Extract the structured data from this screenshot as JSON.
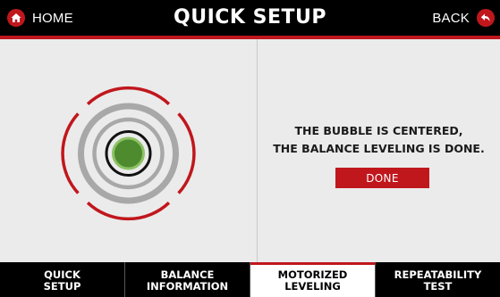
{
  "header": {
    "home_label": "HOME",
    "title": "QUICK SETUP",
    "back_label": "BACK"
  },
  "icons": {
    "home": "home-icon",
    "back": "back-arrow-icon"
  },
  "status": {
    "line1": "THE BUBBLE IS CENTERED,",
    "line2": "THE BALANCE LEVELING IS DONE."
  },
  "actions": {
    "done_label": "DONE"
  },
  "tabs": [
    {
      "line1": "QUICK",
      "line2": "SETUP",
      "active": false
    },
    {
      "line1": "BALANCE",
      "line2": "INFORMATION",
      "active": false
    },
    {
      "line1": "MOTORIZED",
      "line2": "LEVELING",
      "active": true
    },
    {
      "line1": "REPEATABILITY",
      "line2": "TEST",
      "active": false
    }
  ],
  "colors": {
    "accent": "#c0171d",
    "bubble": "#4e8a2e",
    "ring": "#a8a8a8",
    "bar": "#000000"
  }
}
